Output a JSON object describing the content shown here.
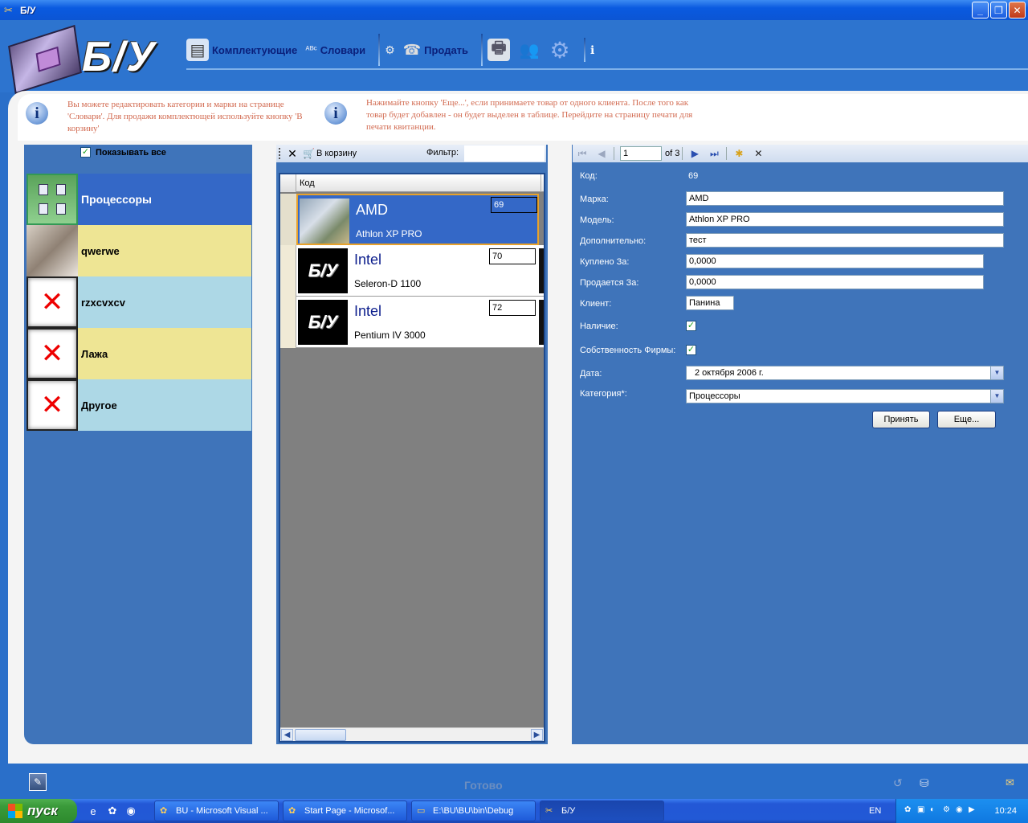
{
  "window": {
    "title": "Б/У"
  },
  "logo": {
    "text": "Б/У"
  },
  "toolbar": {
    "components_label": "Комплектующие",
    "dictionaries_label": "Словари",
    "sell_label": "Продать"
  },
  "info": {
    "left_text": "Вы можете редактировать категории и марки на странице 'Словари'. Для продажи комплектющей используйте кнопку 'В корзину'",
    "right_text": "Нажимайте кнопку 'Еще...', если принимаете товар от одного клиента. После того как товар будет добавлен - он будет выделен в таблице. Перейдите на страницу печати для печати квитанции."
  },
  "categories": {
    "show_all_label": "Показывать все",
    "items": [
      {
        "label": "Процессоры"
      },
      {
        "label": "qwerwe"
      },
      {
        "label": "rzxcvxcv"
      },
      {
        "label": "Лажа"
      },
      {
        "label": "Другое"
      }
    ]
  },
  "grid": {
    "to_cart_label": "В корзину",
    "filter_label": "Фильтр:",
    "filter_value": "",
    "column_code": "Код",
    "rows": [
      {
        "brand": "AMD",
        "model": "Athlon XP PRO",
        "code": "69",
        "logo": ""
      },
      {
        "brand": "Intel",
        "model": "Seleron-D 1100",
        "code": "70",
        "logo": "Б/У"
      },
      {
        "brand": "Intel",
        "model": "Pentium IV 3000",
        "code": "72",
        "logo": "Б/У"
      }
    ]
  },
  "navigator": {
    "position": "1",
    "of_text": "of 3"
  },
  "details": {
    "code_label": "Код:",
    "code_value": "69",
    "brand_label": "Марка:",
    "brand_value": "AMD",
    "model_label": "Модель:",
    "model_value": "Athlon XP PRO",
    "extra_label": "Дополнительно:",
    "extra_value": "тест",
    "bought_label": "Куплено За:",
    "bought_value": "0,0000",
    "sold_label": "Продается За:",
    "sold_value": "0,0000",
    "client_label": "Клиент:",
    "client_value": "Панина",
    "available_label": "Наличие:",
    "available": true,
    "company_label": "Собственность Фирмы:",
    "company": true,
    "date_label": "Дата:",
    "date_value": "2  октября  2006 г.",
    "category_label": "Категория*:",
    "category_value": "Процессоры",
    "accept_label": "Принять",
    "more_label": "Еще..."
  },
  "status": {
    "text": "Готово"
  },
  "taskbar": {
    "start_label": "пуск",
    "tasks": [
      {
        "label": "BU - Microsoft Visual ..."
      },
      {
        "label": "Start Page - Microsof..."
      },
      {
        "label": "E:\\BU\\BU\\bin\\Debug"
      },
      {
        "label": "Б/У"
      }
    ],
    "lang": "EN",
    "clock": "10:24"
  },
  "colors": {
    "accent": "#2a6fc9",
    "selected_row": "#3468c7",
    "info_text": "#d26a50"
  }
}
